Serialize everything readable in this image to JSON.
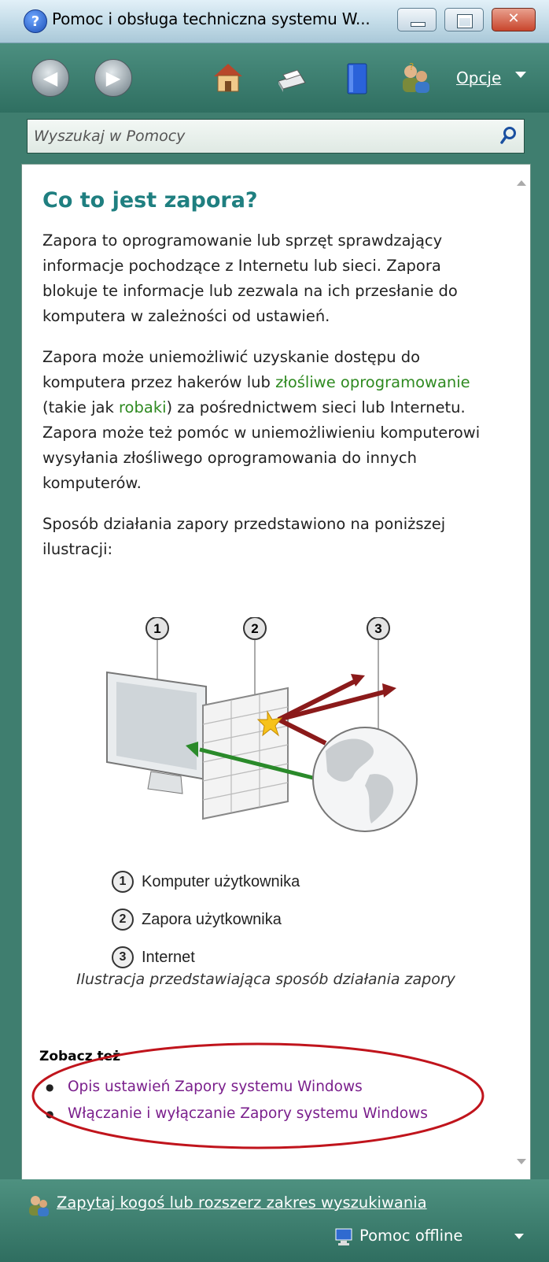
{
  "window": {
    "title": "Pomoc i obsługa techniczna systemu W...",
    "help_icon": "help-icon"
  },
  "toolbar": {
    "options_label": "Opcje"
  },
  "search": {
    "placeholder": "Wyszukaj w Pomocy"
  },
  "article": {
    "title": "Co to jest zapora?",
    "p1": "Zapora to oprogramowanie lub sprzęt sprawdzający informacje pochodzące z Internetu lub sieci. Zapora blokuje te informacje lub zezwala na ich przesłanie do komputera w zależności od ustawień.",
    "p2_before": "Zapora może uniemożliwić uzyskanie dostępu do komputera przez hakerów lub ",
    "p2_link1": "złośliwe oprogramowanie",
    "p2_mid": " (takie jak ",
    "p2_link2": "robaki",
    "p2_after": ") za pośrednictwem sieci lub Internetu. Zapora może też pomóc w uniemożliwieniu komputerowi wysyłania złośliwego oprogramowania do innych komputerów.",
    "p3": "Sposób działania zapory przedstawiono na poniższej ilustracji:",
    "figure_numbers": [
      "1",
      "2",
      "3"
    ],
    "legend": [
      {
        "num": "1",
        "label": "Komputer użytkownika"
      },
      {
        "num": "2",
        "label": "Zapora użytkownika"
      },
      {
        "num": "3",
        "label": "Internet"
      }
    ],
    "caption": "Ilustracja przedstawiająca sposób działania zapory",
    "see_also_title": "Zobacz też",
    "see_also": [
      "Opis ustawień Zapory systemu Windows",
      "Włączanie i wyłączanie Zapory systemu Windows"
    ]
  },
  "bottom": {
    "ask_label": "Zapytaj kogoś lub rozszerz zakres wyszukiwania",
    "offline_label": "Pomoc offline"
  },
  "colors": {
    "accent_green": "#3f7e6f",
    "heading_teal": "#1f7f80",
    "link_green": "#2f8a21",
    "link_purple": "#7a1f8c",
    "annotation_red": "#c0141c"
  }
}
